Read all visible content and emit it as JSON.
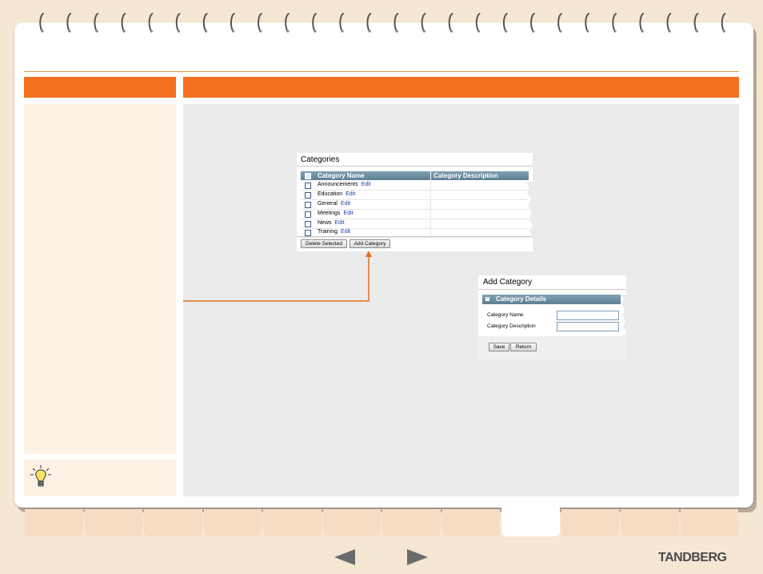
{
  "categories_screen": {
    "title": "Categories",
    "columns": [
      "Category Name",
      "Category Description"
    ],
    "rows": [
      {
        "name": "Announcements",
        "edit": "Edit"
      },
      {
        "name": "Education",
        "edit": "Edit"
      },
      {
        "name": "General",
        "edit": "Edit"
      },
      {
        "name": "Meetings",
        "edit": "Edit"
      },
      {
        "name": "News",
        "edit": "Edit"
      },
      {
        "name": "Training",
        "edit": "Edit"
      }
    ],
    "buttons": {
      "delete": "Delete Selected",
      "add": "Add Category"
    }
  },
  "add_category_screen": {
    "title": "Add Category",
    "group_title": "Category Details",
    "fields": [
      {
        "label": "Category Name",
        "value": ""
      },
      {
        "label": "Category Description",
        "value": ""
      }
    ],
    "buttons": {
      "save": "Save",
      "return": "Return"
    }
  },
  "brand": "TANDBERG",
  "colors": {
    "accent": "#f2701f",
    "panel": "#fdf0e4",
    "grid_header": "#6f93a6"
  },
  "icons": [
    "binder-ring-icon",
    "lightbulb-icon",
    "previous-arrow-icon",
    "next-arrow-icon"
  ],
  "tabs_count": 12,
  "active_tab_index": 8
}
